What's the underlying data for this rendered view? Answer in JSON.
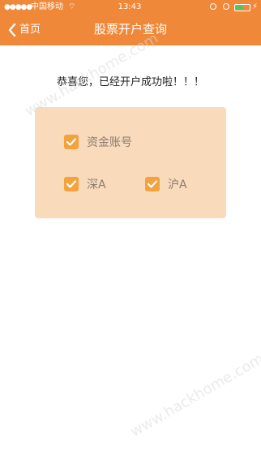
{
  "status_bar": {
    "signal": "●●●●●",
    "carrier": "中国移动",
    "wifi": "⌔",
    "time": "13:43",
    "battery_level": 0.55,
    "battery_color": "#56c35d",
    "charge_icon": "⚡"
  },
  "header": {
    "back_label": "首页",
    "title": "股票开户查询",
    "color": "#f0883a"
  },
  "main": {
    "message": "恭喜您，已经开户成功啦！！！"
  },
  "card": {
    "bg_color": "#f9dbbc",
    "options": [
      {
        "label": "资金账号",
        "checked": true
      },
      {
        "label": "深A",
        "checked": true
      },
      {
        "label": "沪A",
        "checked": true
      }
    ]
  },
  "watermark": {
    "text": "www.hackhome.com"
  },
  "icons": {
    "back": "chevron-left-icon",
    "checkbox": "check-icon"
  }
}
